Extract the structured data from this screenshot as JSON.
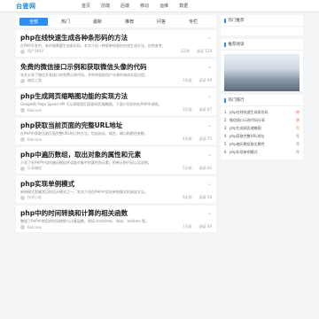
{
  "header": {
    "logo": "台鉴网",
    "nav": [
      "首页",
      "前端",
      "后端",
      "移动",
      "运维",
      "数据"
    ]
  },
  "tabs": [
    "全部",
    "热门",
    "最新",
    "推荐",
    "问答",
    "专栏"
  ],
  "active_tab": 0,
  "articles": [
    {
      "title": "php在线快速生成各种条形码的方法",
      "desc": "在PHP开发中，有时候需要生成条形码，本文介绍一种简单快速的在线生成方法，仅供参考。",
      "author": "用户3642",
      "time": "2天前",
      "views": "阅读 128"
    },
    {
      "title": "免费的微信接口示例和获取微信头像的代码",
      "desc": "本文分享了微信开发接口的免费示例代码，并附带获取用户头像的具体实现过程。",
      "author": "编程之路",
      "time": "3天前",
      "views": "阅读 96"
    },
    {
      "title": "php生成网页缩略图功能的实现方法",
      "desc": "Google的 Page Speed API 可以帮助我们获取网页缩略图，下面介绍如何在PHP中调用。",
      "author": "Balcone",
      "time": "3天前",
      "views": "阅读 87"
    },
    {
      "title": "php获取当前页面的完整URL地址",
      "desc": "在PHP中获取当前页面完整URL的几种方法，包括协议、域名、端口和路径参数。",
      "author": "Balcone",
      "time": "4天前",
      "views": "阅读 75"
    },
    {
      "title": "php中遍历数组，取出对象的属性和元素",
      "desc": "介绍了在PHP中如何遍历数组并读取对象中的属性和元素，附带示例代码以及说明。",
      "author": "乐享编程",
      "time": "5天前",
      "views": "阅读 64"
    },
    {
      "title": "php实现单例模式",
      "desc": "单例模式是最常见的设计模式之一，本文介绍在PHP中实现单例模式的具体方法。",
      "author": "技术小站",
      "time": "6天前",
      "views": "阅读 58"
    },
    {
      "title": "php中的时间转换和计算的相关函数",
      "desc": "整理了PHP中常用的时间转换与计算函数，例如 strtotime、date、mktime 等。",
      "author": "Balcone",
      "time": "7天前",
      "views": "阅读 49"
    }
  ],
  "sidebar": {
    "box1_title": "热门推荐",
    "box2_title": "推荐阅读",
    "box3_title": "热门排行",
    "ranking": [
      {
        "num": "1",
        "text": "php在线快速生成条形码",
        "badge": "热",
        "color": "#f5564e"
      },
      {
        "num": "2",
        "text": "微信接口示例代码分享",
        "badge": "热",
        "color": "#f5564e"
      },
      {
        "num": "3",
        "text": "php生成网页缩略图",
        "badge": "荐",
        "color": "#ff9d2b"
      },
      {
        "num": "4",
        "text": "php获取完整URL地址",
        "badge": "荐",
        "color": "#999999"
      },
      {
        "num": "5",
        "text": "php遍历数组取出属性",
        "badge": "荐",
        "color": "#999999"
      },
      {
        "num": "6",
        "text": "php实现单例模式",
        "badge": "荐",
        "color": "#999999"
      }
    ]
  }
}
